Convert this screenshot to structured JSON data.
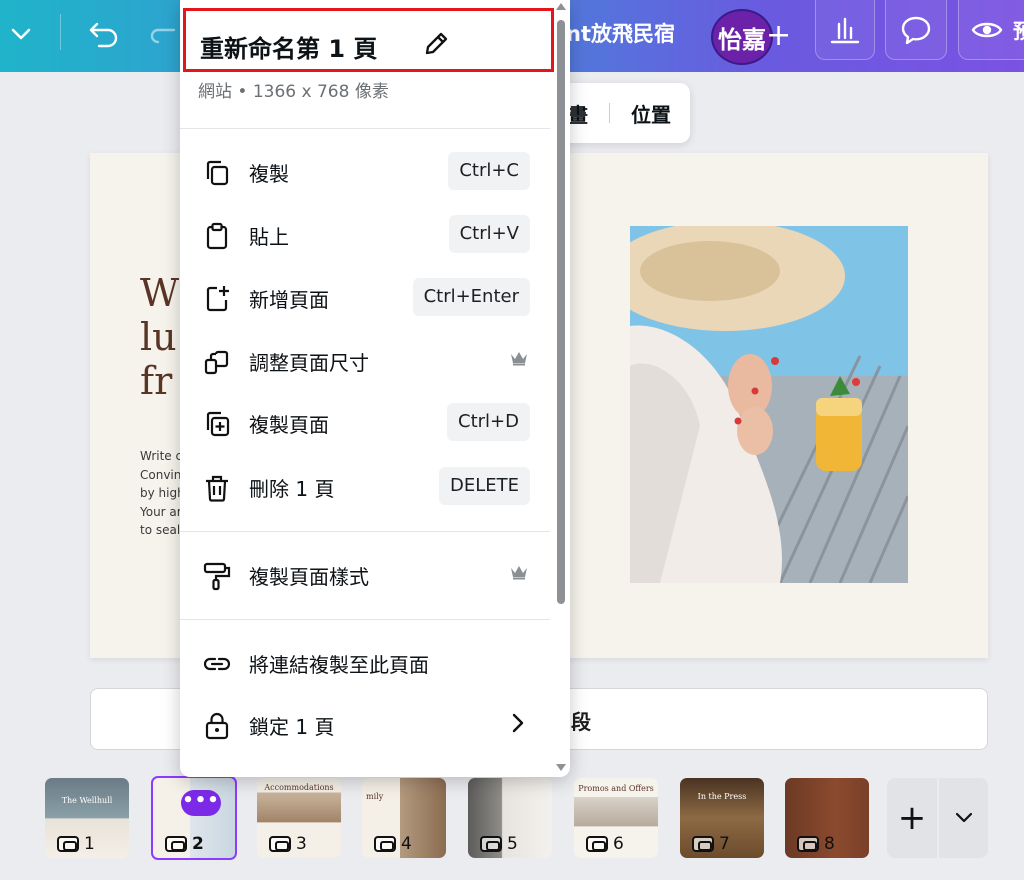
{
  "topbar": {
    "doc_title_partial": "nt放飛民宿",
    "avatar_text": "怡嘉",
    "view_label_partial": "預"
  },
  "float_toolbar": {
    "animate_partial": "畫",
    "position": "位置"
  },
  "canvas": {
    "heading_lines": [
      "W",
      "lu",
      "fr"
    ],
    "body_lines": [
      "Write c",
      "Convin",
      "by high",
      "Your ar",
      "to seal"
    ]
  },
  "add_section": {
    "label_partial": "段"
  },
  "context_menu": {
    "title": "重新命名第 1 頁",
    "subtitle": "網站 • 1366 x 768 像素",
    "items": [
      {
        "label": "複製",
        "shortcut": "Ctrl+C",
        "icon": "copy-icon"
      },
      {
        "label": "貼上",
        "shortcut": "Ctrl+V",
        "icon": "clipboard-icon"
      },
      {
        "label": "新增頁面",
        "shortcut": "Ctrl+Enter",
        "icon": "add-page-icon"
      },
      {
        "label": "調整頁面尺寸",
        "premium": true,
        "icon": "resize-icon"
      },
      {
        "label": "複製頁面",
        "shortcut": "Ctrl+D",
        "icon": "duplicate-page-icon"
      },
      {
        "label": "刪除 1 頁",
        "shortcut": "DELETE",
        "icon": "trash-icon"
      },
      {
        "label": "複製頁面樣式",
        "premium": true,
        "icon": "paint-roller-icon"
      },
      {
        "label": "將連結複製至此頁面",
        "icon": "link-icon"
      },
      {
        "label": "鎖定 1 頁",
        "submenu": true,
        "icon": "lock-icon"
      }
    ]
  },
  "pages": [
    {
      "number": "1",
      "title": "The Wellhull",
      "active": false
    },
    {
      "number": "2",
      "title": "",
      "active": true
    },
    {
      "number": "3",
      "title": "Accommodations",
      "active": false
    },
    {
      "number": "4",
      "title": "mily",
      "active": false
    },
    {
      "number": "5",
      "title": "",
      "active": false
    },
    {
      "number": "6",
      "title": "Promos and Offers",
      "active": false
    },
    {
      "number": "7",
      "title": "In the Press",
      "active": false
    },
    {
      "number": "8",
      "title": "",
      "active": false
    }
  ],
  "active_page_more": "•••"
}
